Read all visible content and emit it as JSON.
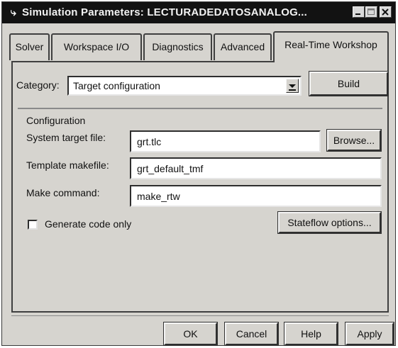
{
  "window": {
    "title": "Simulation Parameters: LECTURADEDATOSANALOG...",
    "icon": "simulink-icon"
  },
  "tabs": [
    {
      "label": "Solver",
      "active": false
    },
    {
      "label": "Workspace I/O",
      "active": false
    },
    {
      "label": "Diagnostics",
      "active": false
    },
    {
      "label": "Advanced",
      "active": false
    },
    {
      "label": "Real-Time Workshop",
      "active": true
    }
  ],
  "category": {
    "label": "Category:",
    "value": "Target configuration",
    "build_label": "Build"
  },
  "configuration": {
    "heading": "Configuration",
    "system_target_label": "System target file:",
    "system_target_value": "grt.tlc",
    "browse_label": "Browse...",
    "template_makefile_label": "Template makefile:",
    "template_makefile_value": "grt_default_tmf",
    "make_command_label": "Make command:",
    "make_command_value": "make_rtw",
    "generate_code_label": "Generate code only",
    "generate_code_checked": false,
    "stateflow_label": "Stateflow options..."
  },
  "footer": {
    "ok_label": "OK",
    "cancel_label": "Cancel",
    "help_label": "Help",
    "apply_label": "Apply"
  }
}
